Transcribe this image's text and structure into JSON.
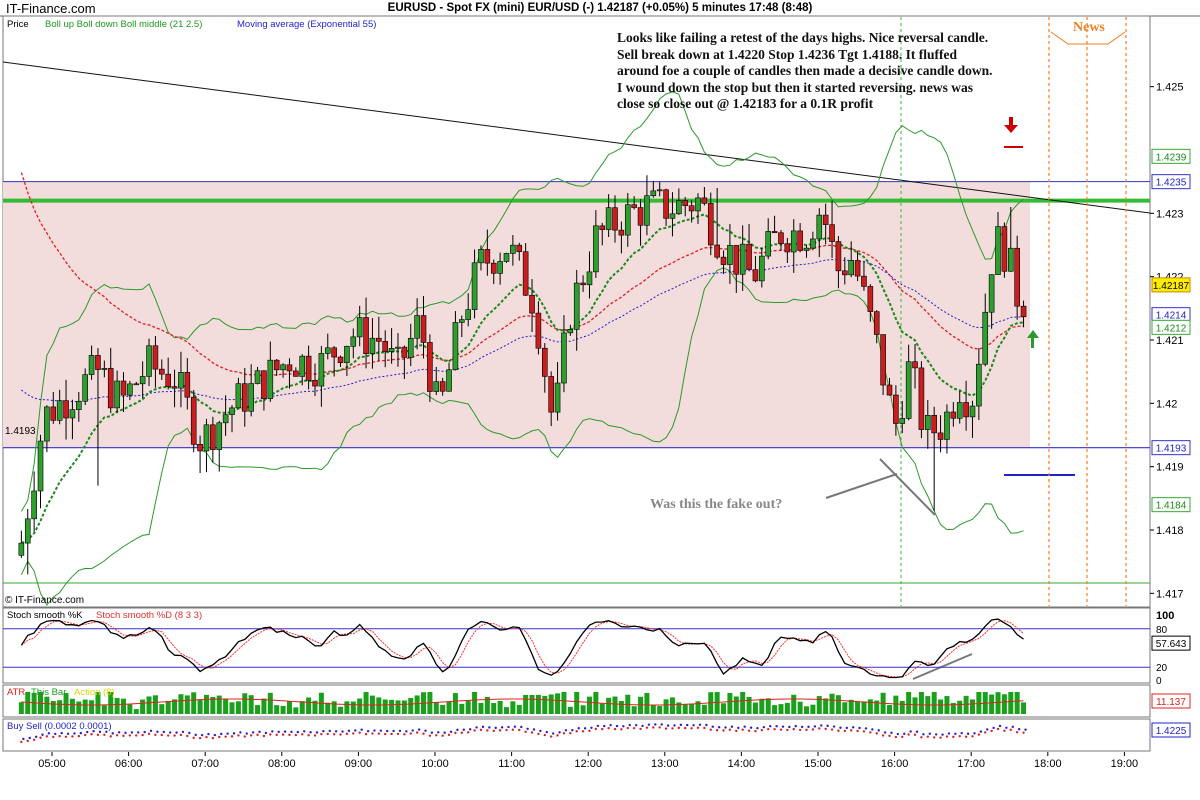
{
  "header": {
    "site": "IT-Finance.com",
    "title": "EURUSD - Spot FX (mini) EUR/USD (-)    1.42187 (+0.05%)    5 minutes  17:48 (8:48)"
  },
  "price_panel": {
    "label": "Price",
    "boll_label": "Boll up Boll down Boll middle (21 2.5)",
    "ema_label": "Moving average (Exponential 55)",
    "copyright": "© IT-Finance.com"
  },
  "annotations": {
    "main_note": "Looks like failing a retest of the days highs.  Nice reversal candle.  Sell break down at 1.4220 Stop 1.4236 Tgt 1.4188.  It fluffed around foe a couple of candles then made a decisive candle down.  I wound down the stop but then it started reversing.  news was close so close out @ 1.42183 for a 0.1R profit",
    "fake_out": "Was this the fake out?",
    "news": "News",
    "left_price": "1.4193"
  },
  "stoch_panel": {
    "label_k": "Stoch smooth %K",
    "label_d": "Stoch smooth %D (8 3 3)",
    "value_label": "57.643",
    "ticks": [
      "100",
      "80",
      "20",
      "0"
    ]
  },
  "atr_panel": {
    "label": "ATR",
    "label2": "This Bar",
    "label3": "Action (8)",
    "value_label": "11.137"
  },
  "bs_panel": {
    "label": "Buy Sell (0.0002 0.0001)",
    "value_label": "1.4225"
  },
  "colors": {
    "up": "#2e9e2e",
    "down": "#c81e1e",
    "zone": "#f3dcdc",
    "boll": "#2a9a2a",
    "ema": "#2020d0",
    "resistance": "#33bb33",
    "news_line": "#ff7a1a",
    "stoch_k": "#000000",
    "stoch_d": "#ff3030"
  },
  "chart_data": {
    "type": "candlestick",
    "title": "EURUSD - Spot FX (mini) EUR/USD (-) 1.42187 (+0.05%) 5 minutes 17:48 (8:48)",
    "x_ticks": [
      "05:00",
      "06:00",
      "07:00",
      "08:00",
      "09:00",
      "10:00",
      "11:00",
      "12:00",
      "13:00",
      "14:00",
      "15:00",
      "16:00",
      "17:00",
      "18:00",
      "19:00"
    ],
    "y_ticks": [
      "1.425",
      "1.423",
      "1.422",
      "1.421",
      "1.42",
      "1.419",
      "1.418",
      "1.417"
    ],
    "ylim": [
      1.4168,
      1.4261
    ],
    "price_labels": [
      "1.4239",
      "1.4235",
      "1.42187",
      "1.4214",
      "1.4212",
      "1.4193",
      "1.4184"
    ],
    "levels": {
      "zone_top": 1.4235,
      "zone_bottom": 1.4193,
      "resistance": 1.4232,
      "entry_target_line": 1.4188,
      "stop_marker": 1.4236
    },
    "notable_lows": [
      1.4173,
      1.4183
    ],
    "notable_highs": [
      1.4234,
      1.4232,
      1.4231
    ]
  }
}
